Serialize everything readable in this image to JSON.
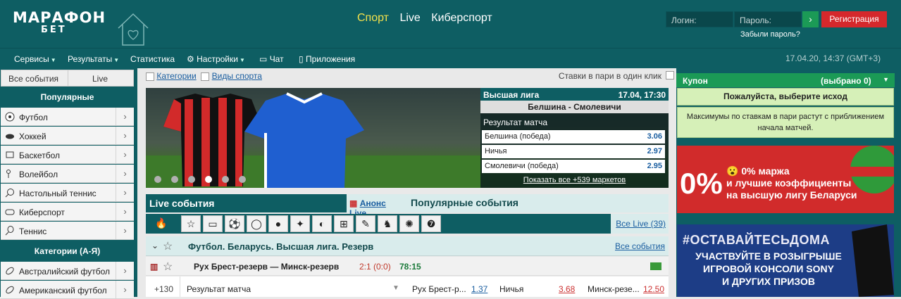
{
  "brand": {
    "name": "МАРАФОН",
    "sub": "БЕТ"
  },
  "main_nav": [
    {
      "label": "Спорт",
      "active": true
    },
    {
      "label": "Live"
    },
    {
      "label": "Киберспорт"
    }
  ],
  "auth": {
    "login_placeholder": "Логин:",
    "password_placeholder": "Пароль:",
    "go": "›",
    "register": "Регистрация",
    "forgot": "Забыли пароль?"
  },
  "sub_nav": {
    "services": "Сервисы",
    "results": "Результаты",
    "stats": "Статистика",
    "settings": "Настройки",
    "chat": "Чат",
    "apps": "Приложения",
    "datetime": "17.04.20, 14:37 (GMT+3)"
  },
  "left": {
    "tab_all": "Все события",
    "tab_live": "Live",
    "popular_title": "Популярные",
    "popular": [
      "Футбол",
      "Хоккей",
      "Баскетбол",
      "Волейбол",
      "Настольный теннис",
      "Киберспорт",
      "Теннис"
    ],
    "categories_title": "Категории (А-Я)",
    "categories": [
      "Австралийский футбол",
      "Американский футбол"
    ]
  },
  "center": {
    "filter_categories": "Категории",
    "filter_sports": "Виды спорта",
    "parlay": "Ставки в пари в один клик",
    "banner": {
      "league": "Высшая лига",
      "datetime": "17.04, 17:30",
      "teams": "Белшина - Смолевичи",
      "market": "Результат матча",
      "outcomes": [
        {
          "name": "Белшина (победа)",
          "odd": "3.06"
        },
        {
          "name": "Ничья",
          "odd": "2.97"
        },
        {
          "name": "Смолевичи (победа)",
          "odd": "2.95"
        }
      ],
      "more": "Показать все +539 маркетов",
      "active_slide": 4
    },
    "live_title": "Live события",
    "anons": "Анонс Live",
    "popular_events": "Популярные события",
    "all_live": "Все Live (39)",
    "league": "Футбол. Беларусь. Высшая лига. Резерв",
    "all_events": "Все события",
    "event": {
      "teams": "Рух Брест-резерв — Минск-резерв",
      "score": "2:1 (0:0)",
      "time": "78:15"
    },
    "market": {
      "count": "+130",
      "name": "Результат матча",
      "o1": "Рух Брест-р...",
      "v1": "1.37",
      "o2": "Ничья",
      "v2": "3.68",
      "o3": "Минск-резе...",
      "v3": "12.50"
    }
  },
  "right": {
    "coupon": "Купон",
    "selected": "(выбрано 0)",
    "choose": "Пожалуйста, выберите исход",
    "note": "Максимумы по ставкам в пари растут с приближением начала матчей.",
    "ad1_big": "0%",
    "ad1_lines": [
      "0% маржа",
      "и лучшие коэффициенты",
      "на высшую лигу Беларуси"
    ],
    "ad2_tag": "#ОСТАВАЙТЕСЬДОМА",
    "ad2_lines": [
      "УЧАСТВУЙТЕ В РОЗЫГРЫШЕ",
      "ИГРОВОЙ КОНСОЛИ SONY",
      "И ДРУГИХ ПРИЗОВ"
    ]
  }
}
